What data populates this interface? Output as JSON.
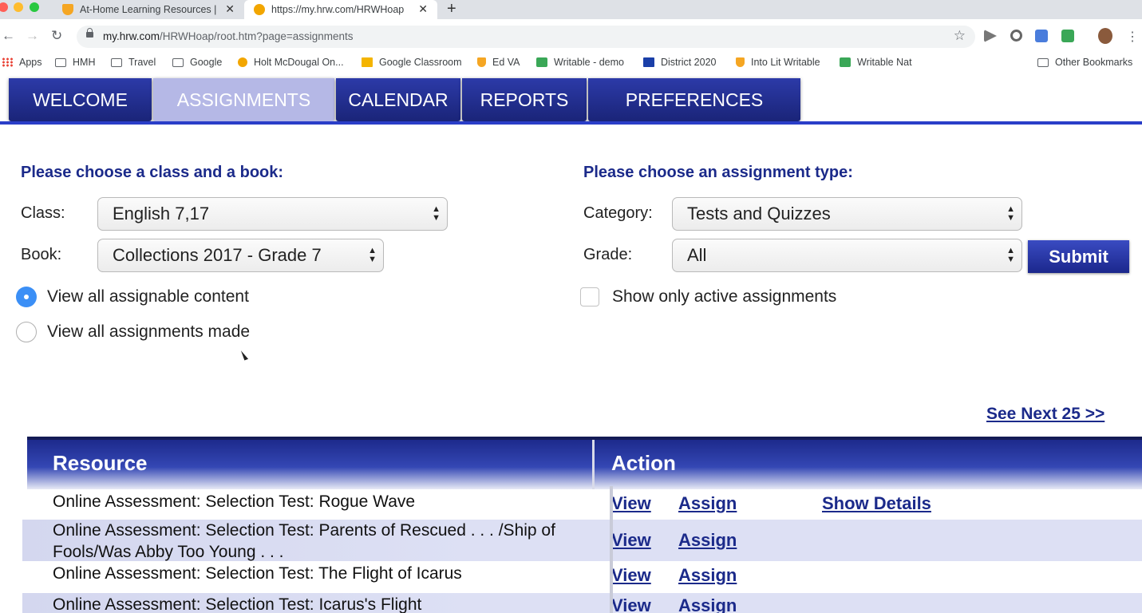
{
  "browser": {
    "tabs": [
      {
        "title": "At-Home Learning Resources |",
        "favicon_color": "#f5a623"
      },
      {
        "title": "https://my.hrw.com/HRWHoap",
        "favicon_color": "#f2a600"
      }
    ],
    "url_host": "my.hrw.com",
    "url_path": "/HRWHoap/root.htm?page=assignments",
    "bookmarks": [
      {
        "label": "Apps",
        "icon": "apps-grid-icon"
      },
      {
        "label": "HMH",
        "icon": "folder-icon"
      },
      {
        "label": "Travel",
        "icon": "folder-icon"
      },
      {
        "label": "Google",
        "icon": "folder-icon"
      },
      {
        "label": "Holt McDougal On...",
        "icon": "circle-favicon-icon"
      },
      {
        "label": "Google Classroom",
        "icon": "classroom-icon"
      },
      {
        "label": "Ed VA",
        "icon": "shield-favicon-icon"
      },
      {
        "label": "Writable - demo",
        "icon": "writable-icon"
      },
      {
        "label": "District 2020",
        "icon": "calendar-favicon-icon"
      },
      {
        "label": "Into Lit Writable",
        "icon": "shield-favicon-icon"
      },
      {
        "label": "Writable Nat",
        "icon": "writable-icon"
      }
    ],
    "other_bookmarks": "Other Bookmarks"
  },
  "nav": {
    "items": [
      "WELCOME",
      "ASSIGNMENTS",
      "CALENDAR",
      "REPORTS",
      "PREFERENCES"
    ],
    "active": "ASSIGNMENTS"
  },
  "left_panel": {
    "heading": "Please choose a class and a book:",
    "class_label": "Class:",
    "class_value": "English 7,17",
    "book_label": "Book:",
    "book_value": "Collections 2017 - Grade 7",
    "radio_options": [
      {
        "label": "View all assignable content",
        "selected": true
      },
      {
        "label": "View all assignments made",
        "selected": false
      }
    ]
  },
  "right_panel": {
    "heading": "Please choose an assignment type:",
    "category_label": "Category:",
    "category_value": "Tests and Quizzes",
    "grade_label": "Grade:",
    "grade_value": "All",
    "submit_label": "Submit",
    "checkbox_label": "Show only active assignments",
    "checkbox_checked": false
  },
  "see_next": "See Next 25 >>",
  "table": {
    "headers": [
      "Resource",
      "Action"
    ],
    "rows": [
      {
        "resource": "Online Assessment: Selection Test: Rogue Wave",
        "actions": [
          "View",
          "Assign",
          "Show Details"
        ]
      },
      {
        "resource": "Online Assessment: Selection Test: Parents of Rescued . . . /Ship of Fools/Was Abby Too Young . . .",
        "actions": [
          "View",
          "Assign"
        ]
      },
      {
        "resource": "Online Assessment: Selection Test: The Flight of Icarus",
        "actions": [
          "View",
          "Assign"
        ]
      },
      {
        "resource": "Online Assessment: Selection Test: Icarus's Flight",
        "actions": [
          "View",
          "Assign"
        ]
      }
    ]
  }
}
